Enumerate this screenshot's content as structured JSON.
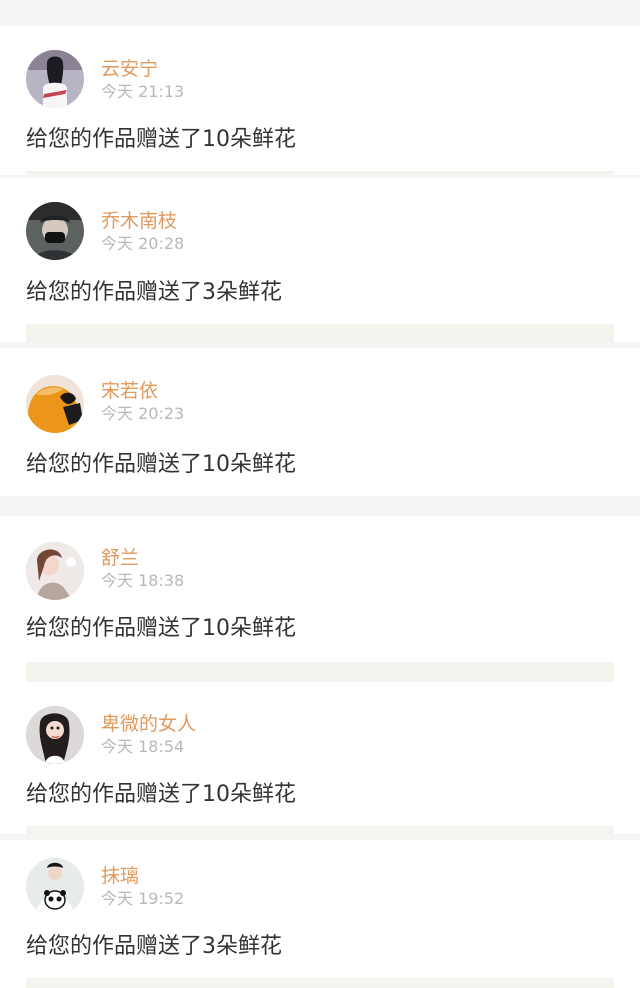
{
  "messages": [
    {
      "username": "云安宁",
      "time": "今天 21:13",
      "text": "给您的作品赠送了10朵鲜花",
      "avatar_icon": "avatar-woman-white-dress"
    },
    {
      "username": "乔木南枝",
      "time": "今天 20:28",
      "text": "给您的作品赠送了3朵鲜花",
      "avatar_icon": "avatar-man-black-mask"
    },
    {
      "username": "宋若依",
      "time": "今天 20:23",
      "text": "给您的作品赠送了10朵鲜花",
      "avatar_icon": "avatar-orange-figure"
    },
    {
      "username": "舒兰",
      "time": "今天 18:38",
      "text": "给您的作品赠送了10朵鲜花",
      "avatar_icon": "avatar-girl-light"
    },
    {
      "username": "卑微的女人",
      "time": "今天 18:54",
      "text": "给您的作品赠送了10朵鲜花",
      "avatar_icon": "avatar-woman-long-hair"
    },
    {
      "username": "抹璃",
      "time": "今天 19:52",
      "text": "给您的作品赠送了3朵鲜花",
      "avatar_icon": "avatar-person-panda-shirt"
    }
  ],
  "colors": {
    "username": "#e09a5e",
    "time": "#b8b8b8",
    "message": "#333333",
    "background": "#f5f5f3",
    "card": "#ffffff"
  }
}
